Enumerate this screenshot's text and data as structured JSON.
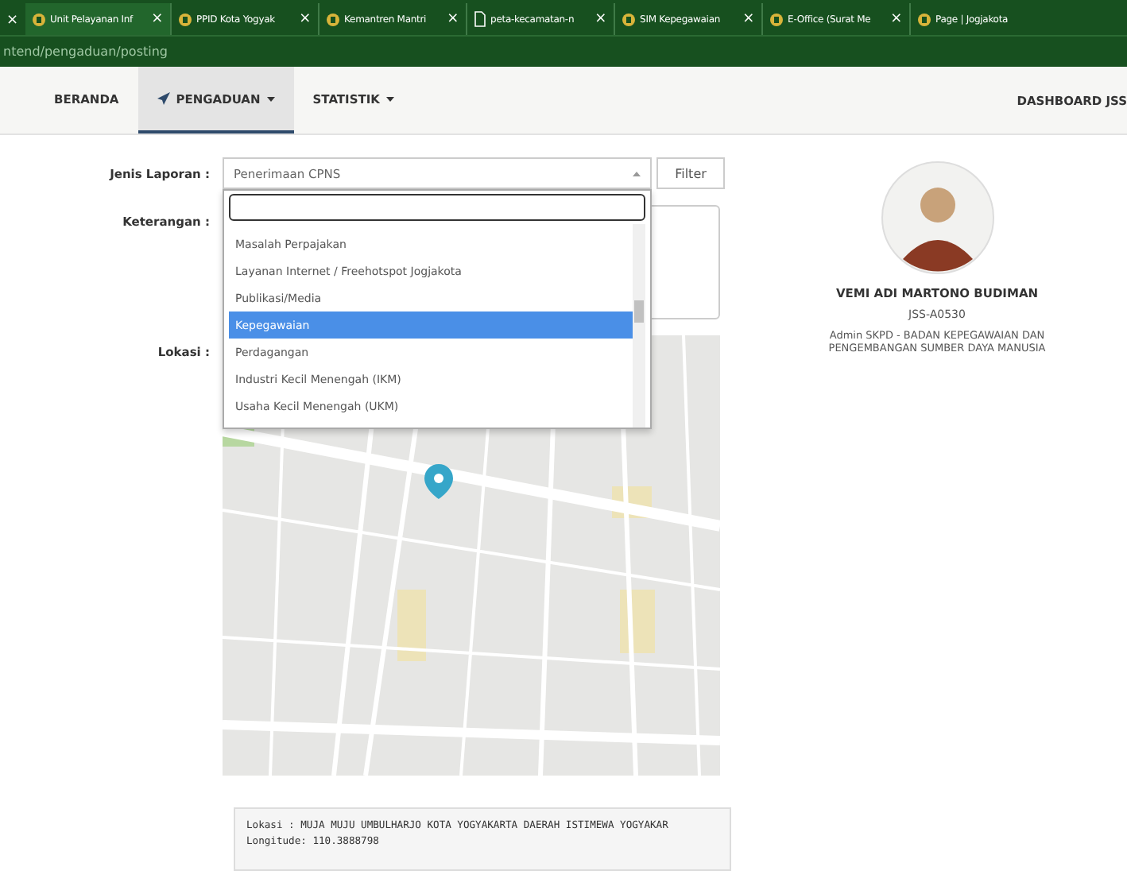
{
  "browser": {
    "close_left": "×",
    "tabs": [
      {
        "title": "Unit Pelayanan Inf",
        "selected": true,
        "kind": "site"
      },
      {
        "title": "PPID Kota Yogyak",
        "selected": false,
        "kind": "site"
      },
      {
        "title": "Kemantren Mantri",
        "selected": false,
        "kind": "site"
      },
      {
        "title": "peta-kecamatan-n",
        "selected": false,
        "kind": "file"
      },
      {
        "title": "SIM Kepegawaian",
        "selected": false,
        "kind": "site"
      },
      {
        "title": "E-Office (Surat Me",
        "selected": false,
        "kind": "site"
      },
      {
        "title": "Page | Jogjakota",
        "selected": false,
        "kind": "site"
      }
    ],
    "close": "×",
    "address": "ntend/pengaduan/posting"
  },
  "nav": {
    "items": [
      {
        "label": "BERANDA",
        "selected": false,
        "dropdown": false,
        "icon": false
      },
      {
        "label": "PENGADUAN",
        "selected": true,
        "dropdown": true,
        "icon": true
      },
      {
        "label": "STATISTIK",
        "selected": false,
        "dropdown": true,
        "icon": false
      }
    ],
    "right": "DASHBOARD JSS"
  },
  "form": {
    "jenis_label": "Jenis Laporan :",
    "jenis_value": "Penerimaan CPNS",
    "filter": "Filter",
    "keterangan_label": "Keterangan :",
    "lokasi_label": "Lokasi :",
    "dropdown": {
      "options": [
        {
          "label": "Masalah Perpajakan",
          "selected": false
        },
        {
          "label": "Layanan Internet / Freehotspot Jogjakota",
          "selected": false
        },
        {
          "label": "Publikasi/Media",
          "selected": false
        },
        {
          "label": "Kepegawaian",
          "selected": true
        },
        {
          "label": "Perdagangan",
          "selected": false
        },
        {
          "label": "Industri Kecil Menengah (IKM)",
          "selected": false
        },
        {
          "label": "Usaha Kecil Menengah (UKM)",
          "selected": false
        }
      ]
    },
    "map": {
      "kind": "picture"
    },
    "info_lines": [
      "Lokasi : MUJA MUJU UMBULHARJO KOTA YOGYAKARTA DAERAH ISTIMEWA YOGYAKAR",
      "Longitude: 110.3888798"
    ]
  },
  "profile": {
    "name": "VEMI ADI MARTONO BUDIMAN",
    "id": "JSS-A0530",
    "role": "Admin SKPD - BADAN KEPEGAWAIAN DAN PENGEMBANGAN SUMBER DAYA MANUSIA"
  }
}
